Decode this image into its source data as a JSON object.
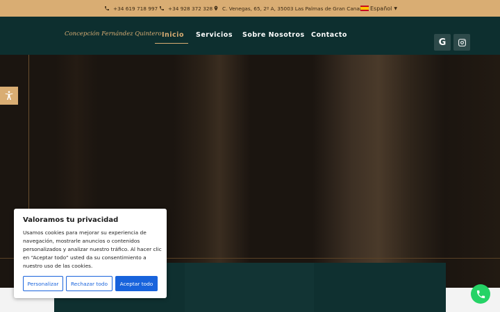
{
  "topbar": {
    "phone1": "+34 619 718 997",
    "phone2": "+34 928 372 328",
    "address": "C. Venegas, 65, 2º A, 35003 Las Palmas de Gran Canaria",
    "language": "Español"
  },
  "nav": {
    "logo": "Concepción Fernández Quintero",
    "items": [
      "Inicio",
      "Servicios",
      "Sobre Nosotros",
      "Contacto"
    ],
    "active": "Inicio"
  },
  "cookie": {
    "title": "Valoramos tu privacidad",
    "body": "Usamos cookies para mejorar su experiencia de navegación, mostrarle anuncios o contenidos personalizados y analizar nuestro tráfico. Al hacer clic en “Aceptar todo” usted da su consentimiento a nuestro uso de las cookies.",
    "customize": "Personalizar",
    "reject": "Rechazar todo",
    "accept": "Aceptar todo"
  },
  "social": {
    "google": "G"
  },
  "colors": {
    "accent": "#d9ad73",
    "nav_bg": "#0d2f2f",
    "cookie_button": "#1863dc",
    "fab": "#25d366"
  }
}
